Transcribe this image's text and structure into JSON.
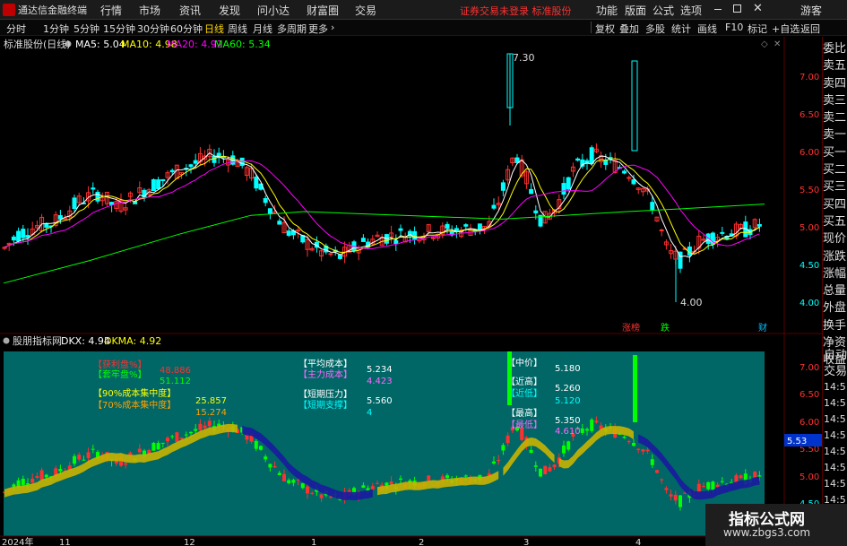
{
  "app": {
    "name": "通达信金融终端"
  },
  "menu": {
    "left": [
      "行情",
      "市场",
      "资讯",
      "发现",
      "问小达",
      "财富圈",
      "交易"
    ],
    "warning": "证券交易未登录  标准股份",
    "right": [
      "功能",
      "版面",
      "公式",
      "选项"
    ],
    "guest": "游客"
  },
  "periods": [
    "分时",
    "1分钟",
    "5分钟",
    "15分钟",
    "30分钟",
    "60分钟",
    "日线",
    "周线",
    "月线",
    "多周期",
    "更多"
  ],
  "active_period": "日线",
  "tools": [
    "复权",
    "叠加",
    "多股",
    "统计",
    "画线",
    "F10",
    "标记",
    "+自选",
    "返回"
  ],
  "main_chart": {
    "stock": "标准股份(日线)",
    "ma": [
      {
        "label": "MA5: 5.04",
        "color": "#ffffff"
      },
      {
        "label": "MA10: 4.98",
        "color": "#ffff00"
      },
      {
        "label": "MA20: 4.92",
        "color": "#ff00ff"
      },
      {
        "label": "MA60: 5.34",
        "color": "#00ff00"
      }
    ],
    "price_labels": [
      "7.00",
      "6.50",
      "6.00",
      "5.50",
      "5.00",
      "4.50",
      "4.00"
    ],
    "annotations": {
      "high": "7.30",
      "low": "4.00"
    },
    "events": [
      {
        "text": "涨",
        "color": "#ff3030"
      },
      {
        "text": "榜",
        "color": "#ff3030"
      },
      {
        "text": "跌",
        "color": "#00ff00"
      },
      {
        "text": "财",
        "color": "#00bfff"
      }
    ]
  },
  "indicator": {
    "name": "股朋指标网",
    "dkx": "DKX: 4.94",
    "dkma": "DKMA: 4.92",
    "labels": [
      {
        "text": "【获利盘%】",
        "value": "48.886",
        "color": "#ff3030",
        "vcolor": "#ff3030"
      },
      {
        "text": "【套牢盘%】",
        "value": "51.112",
        "color": "#00ff00",
        "vcolor": "#00ff00"
      },
      {
        "text": "【90%成本集中度】",
        "value": "25.857",
        "color": "#ffff00",
        "vcolor": "#ffff00"
      },
      {
        "text": "【70%成本集中度】",
        "value": "15.274",
        "color": "#ffa000",
        "vcolor": "#ffa000"
      },
      {
        "text": "【平均成本】",
        "value": "5.234",
        "color": "#ffffff",
        "vcolor": "#ffffff"
      },
      {
        "text": "【主力成本】",
        "value": "4.423",
        "color": "#ff66ff",
        "vcolor": "#ff66ff"
      },
      {
        "text": "【短期压力】",
        "value": "5.560",
        "color": "#ffffff",
        "vcolor": "#ffffff"
      },
      {
        "text": "【短期支撑】",
        "value": "4",
        "color": "#00ffff",
        "vcolor": "#00ffff"
      },
      {
        "text": "【中价】",
        "value": "5.180",
        "color": "#ffffff",
        "vcolor": "#ffffff"
      },
      {
        "text": "【近高】",
        "value": "5.260",
        "color": "#ffffff",
        "vcolor": "#ffffff"
      },
      {
        "text": "【近低】",
        "value": "5.120",
        "color": "#00ffff",
        "vcolor": "#00ffff"
      },
      {
        "text": "【最高】",
        "value": "5.350",
        "color": "#ffffff",
        "vcolor": "#ffffff"
      },
      {
        "text": "【最低】",
        "value": "4.610",
        "color": "#ff66ff",
        "vcolor": "#ff66ff"
      }
    ],
    "price_labels": [
      "7.00",
      "6.50",
      "6.00",
      "5.50",
      "5.00",
      "4.50"
    ],
    "current_price": "5.53"
  },
  "dates": [
    "2024年",
    "11",
    "12",
    "1",
    "2",
    "3",
    "4"
  ],
  "right_panel": {
    "quote_items": [
      "委比",
      "卖五",
      "卖四",
      "卖三",
      "卖二",
      "卖一",
      "买一",
      "买二",
      "买三",
      "买四",
      "买五",
      "现价",
      "涨跌",
      "涨幅",
      "总量",
      "外盘",
      "换手",
      "净资",
      "收益"
    ],
    "tab": "自动",
    "tab2": "交易",
    "times": [
      "14:5",
      "14:5",
      "14:5",
      "14:5",
      "14:5",
      "14:5",
      "14:5",
      "14:5"
    ]
  },
  "watermark": {
    "title": "指标公式网",
    "url": "www.zbgs3.com"
  },
  "colors": {
    "up": "#ff3030",
    "down": "#00ffff",
    "indicator_bg": "#006666",
    "ma60": "#00ff00"
  }
}
